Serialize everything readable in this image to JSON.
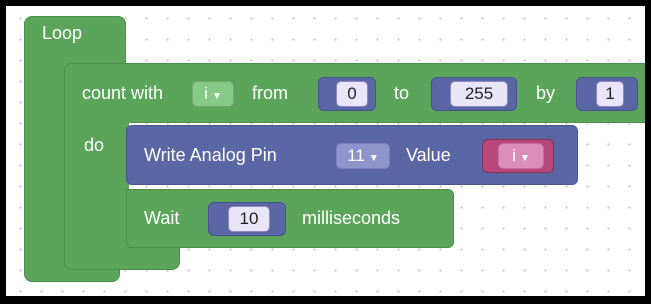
{
  "loop": {
    "label": "Loop"
  },
  "count": {
    "label": "count with",
    "var": "i",
    "from_label": "from",
    "from_value": "0",
    "to_label": "to",
    "to_value": "255",
    "by_label": "by",
    "by_value": "1",
    "do_label": "do"
  },
  "write": {
    "label": "Write Analog Pin",
    "pin": "11",
    "value_label": "Value",
    "value_var": "i"
  },
  "wait": {
    "label": "Wait",
    "value": "10",
    "unit_label": "milliseconds"
  },
  "colors": {
    "loop_green": "#5ba55b",
    "write_blue": "#5b67a5",
    "variable_pink": "#b9487a",
    "number_bg": "#e8e6f8"
  },
  "icons": {
    "dropdown": "triangle-down-icon"
  }
}
